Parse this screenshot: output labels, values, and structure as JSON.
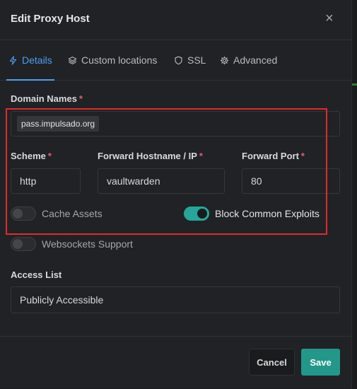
{
  "modal": {
    "title": "Edit Proxy Host",
    "close_symbol": "×"
  },
  "tabs": [
    {
      "label": "Details",
      "icon": "lightning-icon",
      "active": true
    },
    {
      "label": "Custom locations",
      "icon": "layers-icon",
      "active": false
    },
    {
      "label": "SSL",
      "icon": "shield-icon",
      "active": false
    },
    {
      "label": "Advanced",
      "icon": "gear-icon",
      "active": false
    }
  ],
  "form": {
    "domain_names": {
      "label": "Domain Names",
      "required": "*",
      "chips": [
        "pass.impulsado.org"
      ]
    },
    "scheme": {
      "label": "Scheme",
      "required": "*",
      "value": "http"
    },
    "forward_hostname": {
      "label": "Forward Hostname / IP",
      "required": "*",
      "value": "vaultwarden"
    },
    "forward_port": {
      "label": "Forward Port",
      "required": "*",
      "value": "80"
    },
    "cache_assets": {
      "label": "Cache Assets",
      "enabled": false
    },
    "block_common_exploits": {
      "label": "Block Common Exploits",
      "enabled": true
    },
    "websockets_support": {
      "label": "Websockets Support",
      "enabled": false
    },
    "access_list": {
      "label": "Access List",
      "value": "Publicly Accessible"
    }
  },
  "footer": {
    "cancel_label": "Cancel",
    "save_label": "Save"
  },
  "colors": {
    "accent_blue": "#4a9ff5",
    "toggle_on": "#26a69a",
    "save_button": "#23978a",
    "required": "#e35d6a",
    "annotation_box": "#e02b2b"
  }
}
